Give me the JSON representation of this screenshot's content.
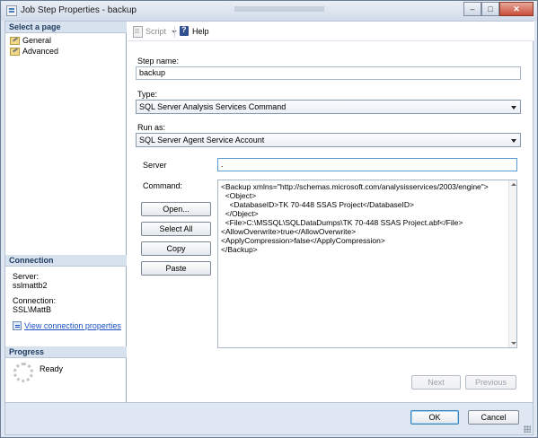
{
  "window": {
    "title": "Job Step Properties - backup",
    "minimize": "–",
    "maximize": "□",
    "close": "✕"
  },
  "left": {
    "select_page_header": "Select a page",
    "pages": [
      {
        "label": "General",
        "icon": "wrench-icon"
      },
      {
        "label": "Advanced",
        "icon": "wrench-icon"
      }
    ],
    "connection_header": "Connection",
    "server_label": "Server:",
    "server_value": "sslmattb2",
    "connection_label": "Connection:",
    "connection_value": "SSL\\MattB",
    "view_link": "View connection properties",
    "progress_header": "Progress",
    "progress_status": "Ready"
  },
  "toolbar": {
    "script": "Script",
    "help": "Help"
  },
  "form": {
    "step_name_label": "Step name:",
    "step_name_value": "backup",
    "type_label": "Type:",
    "type_value": "SQL Server Analysis Services Command",
    "run_as_label": "Run as:",
    "run_as_value": "SQL Server Agent Service Account",
    "server_label": "Server",
    "server_value": ".",
    "command_label": "Command:",
    "command_lines": [
      "<Backup xmlns=\"http://schemas.microsoft.com/analysisservices/2003/engine\">",
      "  <Object>",
      "    <DatabaseID>TK 70-448 SSAS Project</DatabaseID>",
      "  </Object>",
      "  <File>C:\\MSSQL\\SQLDataDumps\\TK 70-448 SSAS Project.abf</File>",
      "<AllowOverwrite>true</AllowOverwrite>",
      "<ApplyCompression>false</ApplyCompression>",
      "</Backup>"
    ],
    "open_btn": "Open...",
    "select_all_btn": "Select All",
    "copy_btn": "Copy",
    "paste_btn": "Paste"
  },
  "nav": {
    "next": "Next",
    "previous": "Previous"
  },
  "footer": {
    "ok": "OK",
    "cancel": "Cancel"
  }
}
